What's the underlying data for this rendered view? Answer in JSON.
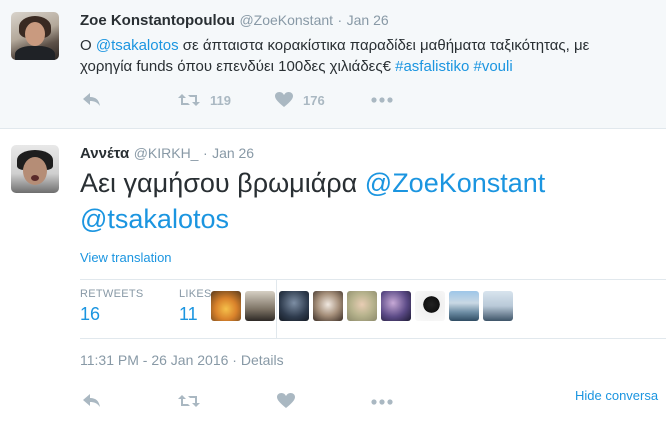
{
  "tweet1": {
    "name": "Zoe Konstantopoulou",
    "handle": "@ZoeKonstant",
    "time": "Jan 26",
    "text_parts": [
      "Ο ",
      "@tsakalotos",
      " σε άπταιστα κορακίστικα παραδίδει μαθήματα ταξικότητας, με χορηγία funds όπου επενδύει 100δες χιλιάδες€ ",
      "#asfalistiko",
      " ",
      "#vouli"
    ],
    "retweets": "119",
    "likes": "176"
  },
  "tweet2": {
    "name": "Αννέτα",
    "handle": "@KIRKH_",
    "time": "Jan 26",
    "text_parts": [
      "Αει γαμήσου βρωμιάρα ",
      "@ZoeKonstant",
      " ",
      "@tsakalotos"
    ],
    "view_translation": "View translation",
    "retweets_label": "RETWEETS",
    "retweets": "16",
    "likes_label": "LIKES",
    "likes": "11",
    "datetime": "11:31 PM - 26 Jan 2016 · Details",
    "hide_conversation": "Hide conversa"
  },
  "icons": {
    "reply": "reply-icon",
    "retweet": "retweet-icon",
    "like": "heart-icon",
    "more": "more-icon"
  },
  "colors": {
    "link": "#1b95e0",
    "muted": "#8899a6",
    "icon": "#aab8c2",
    "text": "#292f33"
  }
}
